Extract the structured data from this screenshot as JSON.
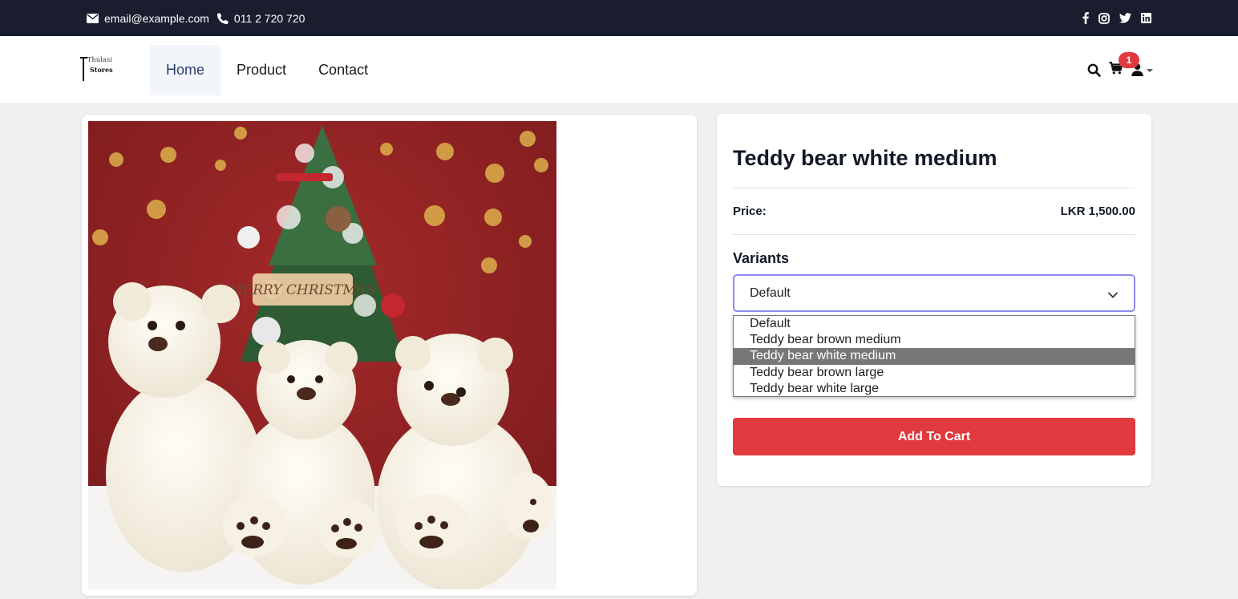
{
  "topbar": {
    "email": "email@example.com",
    "phone": "011 2 720 720",
    "email_icon": "envelope-icon",
    "phone_icon": "phone-icon",
    "social": [
      "facebook-icon",
      "instagram-icon",
      "twitter-icon",
      "linkedin-icon"
    ]
  },
  "brand": {
    "logo_line1": "Thulasi",
    "logo_line2": "Stores"
  },
  "nav": {
    "items": [
      {
        "label": "Home",
        "active": true
      },
      {
        "label": "Product",
        "active": false
      },
      {
        "label": "Contact",
        "active": false
      }
    ],
    "cart_count": "1",
    "icons": [
      "search-icon",
      "cart-icon",
      "user-icon",
      "caret-down-icon"
    ]
  },
  "product": {
    "title": "Teddy bear white medium",
    "price_label": "Price:",
    "price_value": "LKR 1,500.00",
    "variants_label": "Variants",
    "selected_variant": "Default",
    "variant_options": [
      "Default",
      "Teddy bear brown medium",
      "Teddy bear white medium",
      "Teddy bear brown large",
      "Teddy bear white large"
    ],
    "highlighted_option": "Teddy bear white medium",
    "image_text": "MERRY CHRISTMAS",
    "add_to_cart": "Add To Cart"
  },
  "colors": {
    "topbar_bg": "#1a1d2e",
    "accent_red": "#e03a3e",
    "focus_border": "#8b8bf0",
    "nav_active_bg": "#f2f5fa"
  }
}
